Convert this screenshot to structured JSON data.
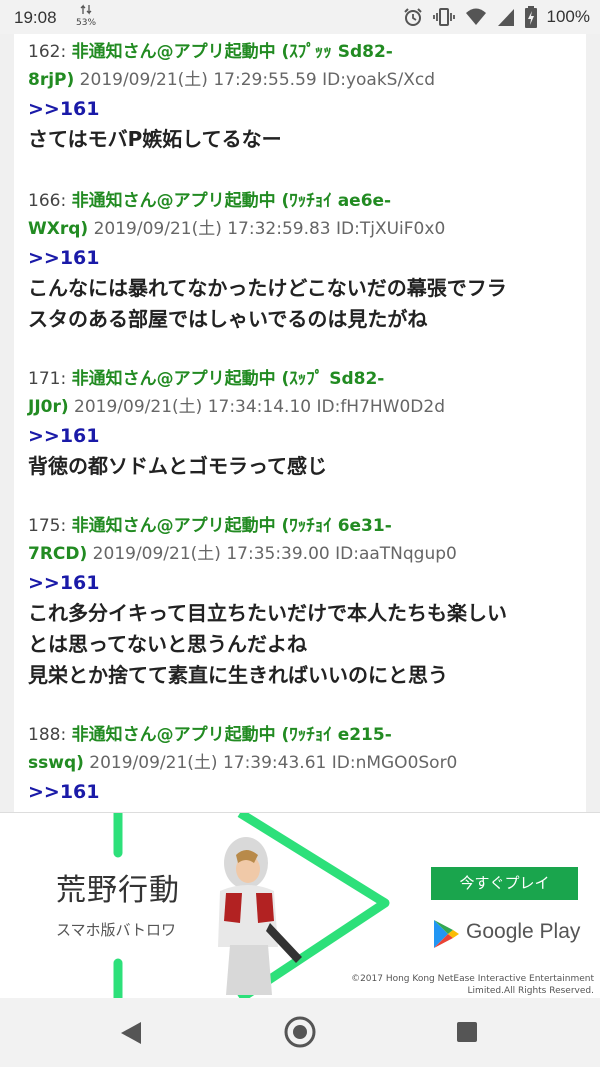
{
  "status_bar": {
    "time": "19:08",
    "network_label": "53%",
    "battery_percent": "100%"
  },
  "posts": [
    {
      "number": "162:",
      "name": "非通知さん@アプリ起動中 (ｽﾌﾟｯｯ Sd82-",
      "name_cont": "8rjP)",
      "meta": " 2019/09/21(土) 17:29:55.59 ID:yoakS/Xcd",
      "anchor": ">>161",
      "lines": [
        "さてはモバP嫉妬してるなー"
      ]
    },
    {
      "number": "166:",
      "name": "非通知さん@アプリ起動中 (ﾜｯﾁｮｲ ae6e-",
      "name_cont": "WXrq)",
      "meta": " 2019/09/21(土) 17:32:59.83 ID:TjXUiF0x0",
      "anchor": ">>161",
      "lines": [
        "こんなには暴れてなかったけどこないだの幕張でフラ",
        "スタのある部屋ではしゃいでるのは見たがね"
      ]
    },
    {
      "number": "171:",
      "name": "非通知さん@アプリ起動中 (ｽｯﾌﾟ Sd82-",
      "name_cont": "JJ0r)",
      "meta": " 2019/09/21(土) 17:34:14.10 ID:fH7HW0D2d",
      "anchor": ">>161",
      "lines": [
        "背徳の都ソドムとゴモラって感じ"
      ]
    },
    {
      "number": "175:",
      "name": "非通知さん@アプリ起動中 (ﾜｯﾁｮｲ 6e31-",
      "name_cont": "7RCD)",
      "meta": " 2019/09/21(土) 17:35:39.00 ID:aaTNqgup0",
      "anchor": ">>161",
      "lines": [
        "これ多分イキって目立ちたいだけで本人たちも楽しい",
        "とは思ってないと思うんだよね",
        "見栄とか捨てて素直に生きればいいのにと思う"
      ]
    },
    {
      "number": "188:",
      "name": "非通知さん@アプリ起動中 (ﾜｯﾁｮｲ e215-",
      "name_cont": "sswq)",
      "meta": " 2019/09/21(土) 17:39:43.61 ID:nMGO0Sor0",
      "anchor": ">>161",
      "lines": []
    }
  ],
  "ad": {
    "title": "荒野行動",
    "subtitle": "スマホ版バトロワ",
    "cta_label": "今すぐプレイ",
    "store_label": "Google Play",
    "copyright_line1": "©2017 Hong Kong NetEase Interactive Entertainment",
    "copyright_line2": "Limited.All Rights Reserved.",
    "accent_color": "#1aa54d"
  },
  "nav_icons": [
    "back-triangle-icon",
    "home-circle-icon",
    "recents-square-icon"
  ]
}
